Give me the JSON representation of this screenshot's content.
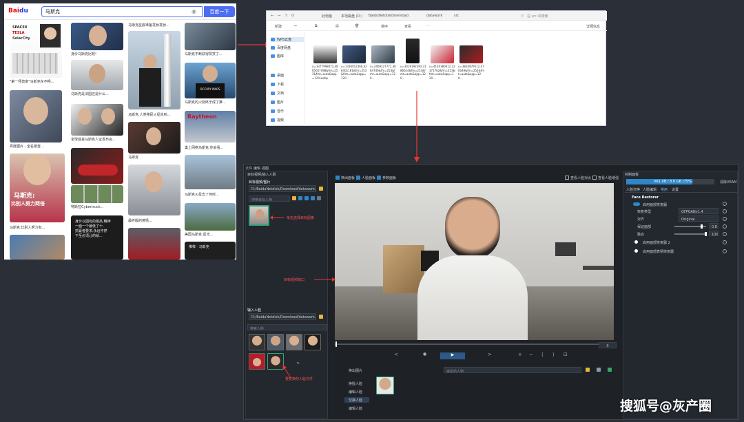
{
  "search": {
    "logo_a": "Bai",
    "logo_b": "du",
    "query": "马斯克",
    "button": "百度一下",
    "captions": [
      "\"第一怪兽家\"马斯克在不畅...",
      "身价马斯克比较!",
      "马斯克星舰准备发射发射...",
      "马斯克不断获得赞赏了...",
      "马斯克是法国还是什么...",
      "马斯克,人类移民火星追到...",
      "马斯克的火箭终于成了推...",
      "百度图片 - 全名最查...",
      "全球首富马斯克人证发布会...",
      "马斯克",
      "巢上网络马斯克,你会看...",
      "特斯拉Cybertruck...",
      "马斯克火星去了何时...",
      "特斯拉Model 3...",
      "最终版的黄扬...",
      "美国马斯克 星光...",
      "马斯克 比别人努力有...",
      "马斯克在全球发布自...",
      "推荐 · 马斯克"
    ],
    "tags": [
      "马斯克:",
      "比别人努力两倍",
      "Raytheon",
      "OCCUPY MARS",
      "SPACEX",
      "TESLA",
      "SolarCity",
      "身价以固有的最高,精神\n一面一个最低了十,\n抓紧者要求,永远不停\n下至必须让的就..."
    ]
  },
  "explorer": {
    "path": [
      "此电脑",
      "本地磁盘 (D:)",
      "BaiduNetdiskDownload",
      "datawork",
      "src"
    ],
    "search_placeholder": "在 src 中搜索",
    "toolbar": [
      "新建",
      "排序",
      "查看",
      "···"
    ],
    "details": "详细信息",
    "sidebar": [
      "WPS云盘",
      "百度网盘",
      "图库",
      "桌面",
      "下载",
      "文档",
      "图片",
      "音乐",
      "视频"
    ],
    "files": [
      "u=3377998072,4865657498&fm=253&fmt=auto&app=120.webp",
      "u=1336012360,426401181&fm=253&fmt=auto&app=120...",
      "u=2469227771,3664746&fm=253&fmt=auto&app=120...",
      "u=3418192392,3186614&fm=253&fmt=auto&app=120...",
      "u=4134380612,22371762&fm=253&fmt=auto&app=120...",
      "u=3834879512,470049&fm=253&fmt=auto&app=120..."
    ]
  },
  "app": {
    "menu": [
      "文件",
      "编辑",
      "视图"
    ],
    "source_title": "目标视频/输入人脸",
    "target_label": "目标视频/图片",
    "target_path": "D:/BaiduNetdisk/Download/datawork...",
    "target_search": "搜索目标人物",
    "input_label": "输入人脸",
    "input_path": "D:/BaiduNetdisk/Download/datawork...",
    "input_search": "搜索人脸",
    "top_checks": [
      "换出面板",
      "人脸面板",
      "参数面板"
    ],
    "top_right_checks": [
      "查看人脸对比",
      "查看人脸增强"
    ],
    "frame_no": "0",
    "ctrl_icons": [
      "<",
      "●",
      "▶",
      ">",
      "+",
      "−",
      "⟨",
      "⟩",
      "⊡"
    ],
    "swap_label": "换出图片",
    "swap_field": "输出后人物",
    "left_tabs": [
      "换脸人脸",
      "编辑人脸",
      "交换人脸",
      "编辑人脸"
    ],
    "props_title": "控制面板",
    "vram": "VR1.0B / 8.0 GB (75%)",
    "vram_fill": 0.75,
    "clear_btn": "清除VRAM",
    "props_tabs": [
      "人脸交换",
      "人脸编辑",
      "常用",
      "设置"
    ],
    "section": "Face Restorer",
    "rows": [
      {
        "label": "启用面部恢复器",
        "value": ""
      },
      {
        "label": "恢复类型",
        "value": "GFPGANv1.4"
      },
      {
        "label": "对齐",
        "value": "Original"
      },
      {
        "label": "保证面部",
        "value": "0.8"
      },
      {
        "label": "融合",
        "value": "100"
      }
    ],
    "options": [
      "启用面部恢复器 2",
      "启用面部表情恢复器"
    ],
    "annotations": [
      "单击选择目标图像",
      "目标视频窗口",
      "要变换的人脸文件"
    ]
  },
  "watermark": "搜狐号@灰产圈",
  "colors": {
    "accent": "#4e6ef2",
    "app_bg": "#1e2227",
    "annotation": "#ff3030",
    "vram": "#2d87c8"
  }
}
